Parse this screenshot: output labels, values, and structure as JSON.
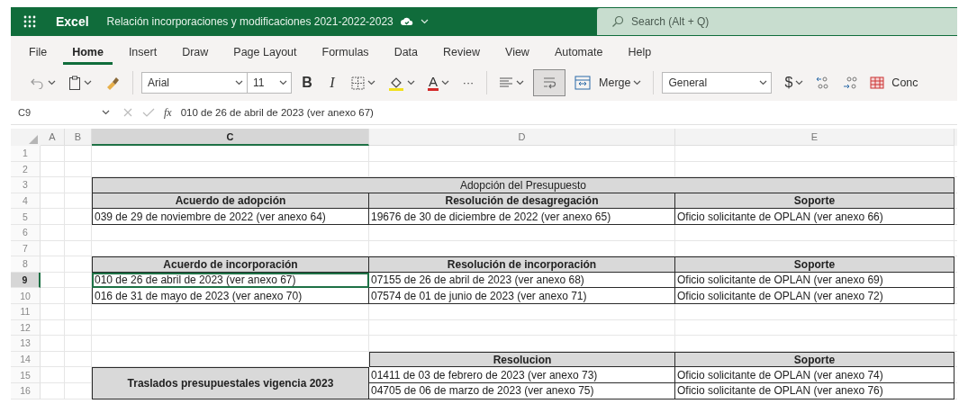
{
  "app": {
    "name": "Excel",
    "document_title": "Relación incorporaciones y modificaciones 2021-2022-2023",
    "search": {
      "placeholder": "Search (Alt + Q)"
    }
  },
  "ribbon_tabs": [
    {
      "label": "File",
      "selected": false
    },
    {
      "label": "Home",
      "selected": true
    },
    {
      "label": "Insert",
      "selected": false
    },
    {
      "label": "Draw",
      "selected": false
    },
    {
      "label": "Page Layout",
      "selected": false
    },
    {
      "label": "Formulas",
      "selected": false
    },
    {
      "label": "Data",
      "selected": false
    },
    {
      "label": "Review",
      "selected": false
    },
    {
      "label": "View",
      "selected": false
    },
    {
      "label": "Automate",
      "selected": false
    },
    {
      "label": "Help",
      "selected": false
    }
  ],
  "toolbar": {
    "font": "Arial",
    "font_size": "11",
    "bold": "B",
    "italic": "I",
    "font_color_letter": "A",
    "more": "···",
    "wrap_text_on": true,
    "merge": "Merge",
    "number_format": "General",
    "currency": "$",
    "conditional_formatting": "Conc"
  },
  "formula_bar": {
    "name_box": "C9",
    "function_label": "fx",
    "formula": "010 de 26 de abril de 2023 (ver anexo 67)"
  },
  "columns": [
    {
      "label": "A",
      "selected": false
    },
    {
      "label": "B",
      "selected": false
    },
    {
      "label": "C",
      "selected": true
    },
    {
      "label": "D",
      "selected": false
    },
    {
      "label": "E",
      "selected": false
    }
  ],
  "rows": [
    {
      "number": "1",
      "selected": false
    },
    {
      "number": "2",
      "selected": false
    },
    {
      "number": "3",
      "selected": false,
      "cells": [
        {
          "kind": "title",
          "text": "Adopción del Presupuesto"
        }
      ]
    },
    {
      "number": "4",
      "selected": false,
      "cells": [
        {
          "kind": "header",
          "text": "Acuerdo de adopción"
        },
        {
          "kind": "header",
          "text": "Resolución de desagregación"
        },
        {
          "kind": "header",
          "text": "Soporte"
        }
      ]
    },
    {
      "number": "5",
      "selected": false,
      "cells": [
        {
          "kind": "data",
          "text": "039 de 29 de noviembre de 2022 (ver anexo 64)"
        },
        {
          "kind": "data",
          "text": "19676 de 30 de diciembre de 2022 (ver anexo 65)"
        },
        {
          "kind": "data",
          "text": "Oficio solicitante de OPLAN  (ver anexo 66)"
        }
      ]
    },
    {
      "number": "6",
      "selected": false
    },
    {
      "number": "7",
      "selected": false
    },
    {
      "number": "8",
      "selected": false,
      "cells": [
        {
          "kind": "header",
          "text": "Acuerdo de incorporación"
        },
        {
          "kind": "header",
          "text": "Resolución de incorporación"
        },
        {
          "kind": "header",
          "text": "Soporte"
        }
      ]
    },
    {
      "number": "9",
      "selected": true,
      "cells": [
        {
          "kind": "data",
          "text": "010 de 26 de abril de 2023 (ver anexo 67)",
          "selected": true
        },
        {
          "kind": "data",
          "text": "07155 de 26 de abril de 2023 (ver anexo 68)"
        },
        {
          "kind": "data",
          "text": "Oficio solicitante de OPLAN  (ver anexo 69)"
        }
      ]
    },
    {
      "number": "10",
      "selected": false,
      "cells": [
        {
          "kind": "data",
          "text": "016 de 31 de mayo de 2023 (ver anexo 70)"
        },
        {
          "kind": "data",
          "text": "07574 de 01 de junio de 2023 (ver anexo 71)"
        },
        {
          "kind": "data",
          "text": "Oficio solicitante de OPLAN  (ver anexo 72)"
        }
      ]
    },
    {
      "number": "11",
      "selected": false
    },
    {
      "number": "12",
      "selected": false
    },
    {
      "number": "13",
      "selected": false
    },
    {
      "number": "14",
      "selected": false,
      "cells": [
        {
          "kind": "blank"
        },
        {
          "kind": "header",
          "text": "Resolucion"
        },
        {
          "kind": "header",
          "text": "Soporte"
        }
      ]
    },
    {
      "number": "15",
      "selected": false,
      "cells": [
        {
          "kind": "tall_header",
          "text": "Traslados presupuestales vigencia 2023"
        },
        {
          "kind": "data",
          "text": "01411 de 03 de febrero de 2023 (ver anexo 73)"
        },
        {
          "kind": "data",
          "text": "Oficio solicitante de OPLAN  (ver anexo 74)"
        }
      ]
    },
    {
      "number": "16",
      "selected": false,
      "cells": [
        {
          "kind": "data",
          "text": "04705 de 06 de marzo de 2023 (ver anexo 75)"
        },
        {
          "kind": "data",
          "text": "Oficio solicitante de OPLAN  (ver anexo 76)"
        }
      ]
    }
  ]
}
